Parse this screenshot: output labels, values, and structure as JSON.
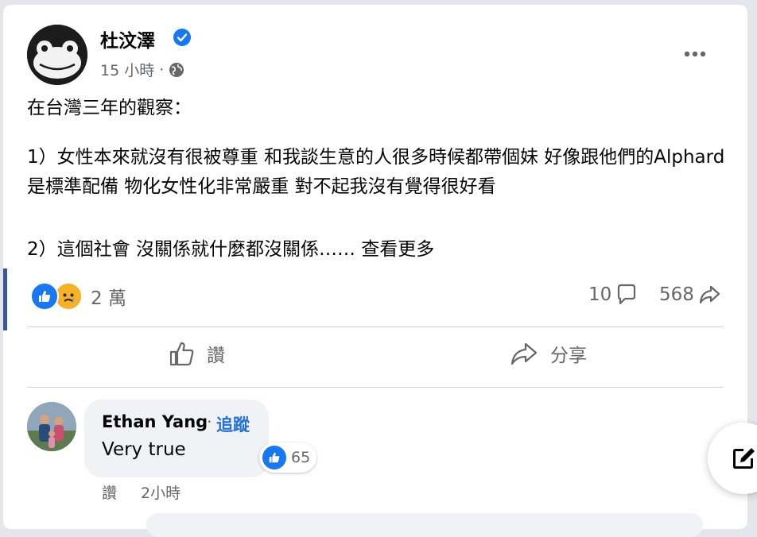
{
  "post": {
    "author": "杜汶澤",
    "time": "15 小時",
    "separator": "·",
    "paragraph1": "在台灣三年的觀察：",
    "paragraph2": "1）女性本來就沒有很被尊重 和我談生意的人很多時候都帶個妹 好像跟他們的Alphard 是標準配備 ￼物化女性化非常嚴重 對不起我沒有覺得很好看",
    "paragraph3_text": "2）這個社會 沒關係就什麼都沒關係…… ",
    "see_more": "查看更多",
    "reaction_count": "2 萬",
    "comment_count": "10",
    "share_count": "568"
  },
  "actions": {
    "like_label": "讚",
    "share_label": "分享"
  },
  "comment": {
    "name": "Ethan Yang",
    "dot": "·",
    "follow_label": "追蹤",
    "text": "Very true",
    "reaction_count": "65",
    "like_label": "讚",
    "time": "2小時"
  },
  "colors": {
    "like_blue": "#1877f2",
    "follow_blue": "#216fdb",
    "muted_gray": "#65676b",
    "sad_yellow": "#f7b125"
  }
}
